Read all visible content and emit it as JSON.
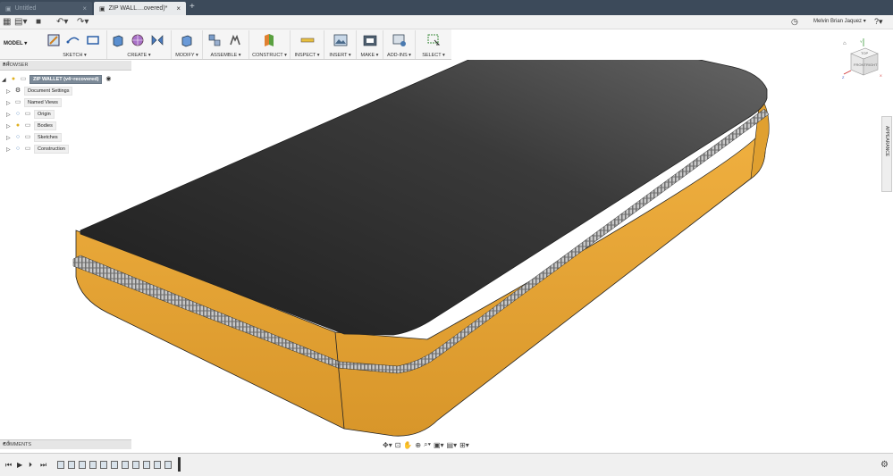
{
  "tabs": [
    {
      "label": "Untitled",
      "active": false
    },
    {
      "label": "ZIP WALL....overed)*",
      "active": true
    }
  ],
  "quickbar": {
    "user": "Melvin Brian Jaquez ▾"
  },
  "ribbon": {
    "workspace": "MODEL ▾",
    "groups": [
      "SKETCH ▾",
      "CREATE ▾",
      "MODIFY ▾",
      "ASSEMBLE ▾",
      "CONSTRUCT ▾",
      "INSPECT ▾",
      "INSERT ▾",
      "MAKE ▾",
      "ADD-INS ▾",
      "SELECT ▾"
    ]
  },
  "browser": {
    "title": "BROWSER",
    "root": "ZIP WALLET (v4~recovered)",
    "items": [
      "Document Settings",
      "Named Views",
      "Origin",
      "Bodies",
      "Sketches",
      "Construction"
    ]
  },
  "comments": {
    "title": "COMMENTS"
  },
  "side_panel": {
    "label": "APPEARANCE"
  },
  "viewcube": {
    "top": "TOP",
    "front": "FRONT",
    "right": "RIGHT",
    "x": "X",
    "y": "Y",
    "z": "Z"
  },
  "colors": {
    "body_orange": "#e8a634",
    "top_dark": "#2d2d2d",
    "zipper": "#8a8a8a",
    "tabbar": "#3c4a5a"
  }
}
